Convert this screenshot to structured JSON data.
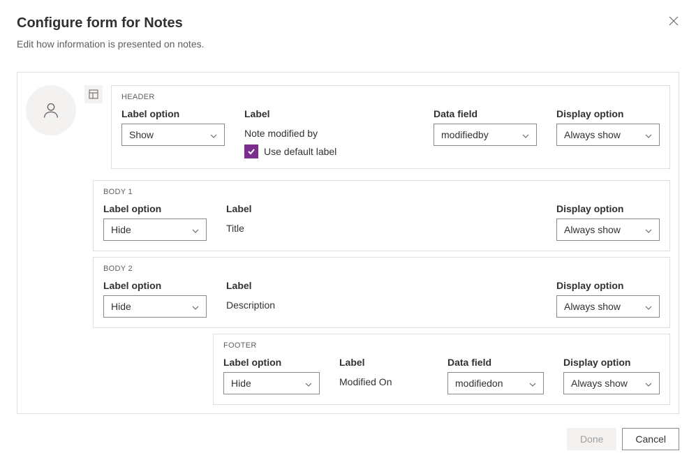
{
  "title": "Configure form for Notes",
  "subtitle": "Edit how information is presented on notes.",
  "labels": {
    "label_option": "Label option",
    "label": "Label",
    "data_field": "Data field",
    "display_option": "Display option",
    "use_default_label": "Use default label"
  },
  "sections": {
    "header": {
      "title": "HEADER",
      "label_option": "Show",
      "label_value": "Note modified by",
      "data_field": "modifiedby",
      "display_option": "Always show",
      "use_default_label": true
    },
    "body1": {
      "title": "BODY 1",
      "label_option": "Hide",
      "label_value": "Title",
      "display_option": "Always show"
    },
    "body2": {
      "title": "BODY 2",
      "label_option": "Hide",
      "label_value": "Description",
      "display_option": "Always show"
    },
    "footer": {
      "title": "FOOTER",
      "label_option": "Hide",
      "label_value": "Modified On",
      "data_field": "modifiedon",
      "display_option": "Always show"
    }
  },
  "buttons": {
    "done": "Done",
    "cancel": "Cancel"
  }
}
